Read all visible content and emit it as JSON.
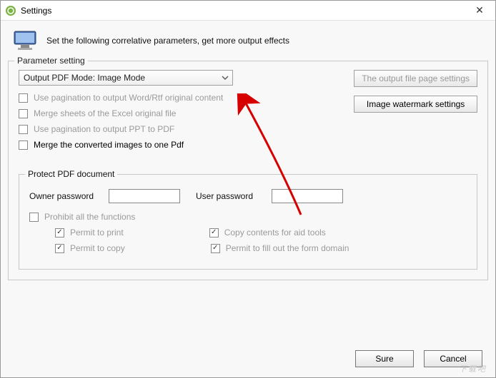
{
  "window": {
    "title": "Settings"
  },
  "header": {
    "subtitle": "Set the following correlative parameters, get more output effects"
  },
  "fieldset": {
    "legend": "Parameter setting"
  },
  "dropdown": {
    "label": "Output PDF Mode: Image Mode"
  },
  "buttons": {
    "page_settings": "The output file page settings",
    "watermark": "Image watermark settings"
  },
  "checks": {
    "pagination_word": "Use pagination to output Word/Rtf original content",
    "merge_excel": "Merge sheets of the Excel original file",
    "pagination_ppt": "Use pagination to output PPT to PDF",
    "merge_images": "Merge the converted images to one Pdf"
  },
  "protect": {
    "legend": "Protect PDF document",
    "owner_label": "Owner password",
    "user_label": "User password",
    "prohibit": "Prohibit all the functions",
    "permit_print": "Permit to print",
    "permit_copy_content": "Copy contents for aid tools",
    "permit_copy": "Permit to copy",
    "permit_fill": "Permit to fill out the form domain"
  },
  "footer": {
    "sure": "Sure",
    "cancel": "Cancel"
  },
  "watermark_text": "下载吧"
}
